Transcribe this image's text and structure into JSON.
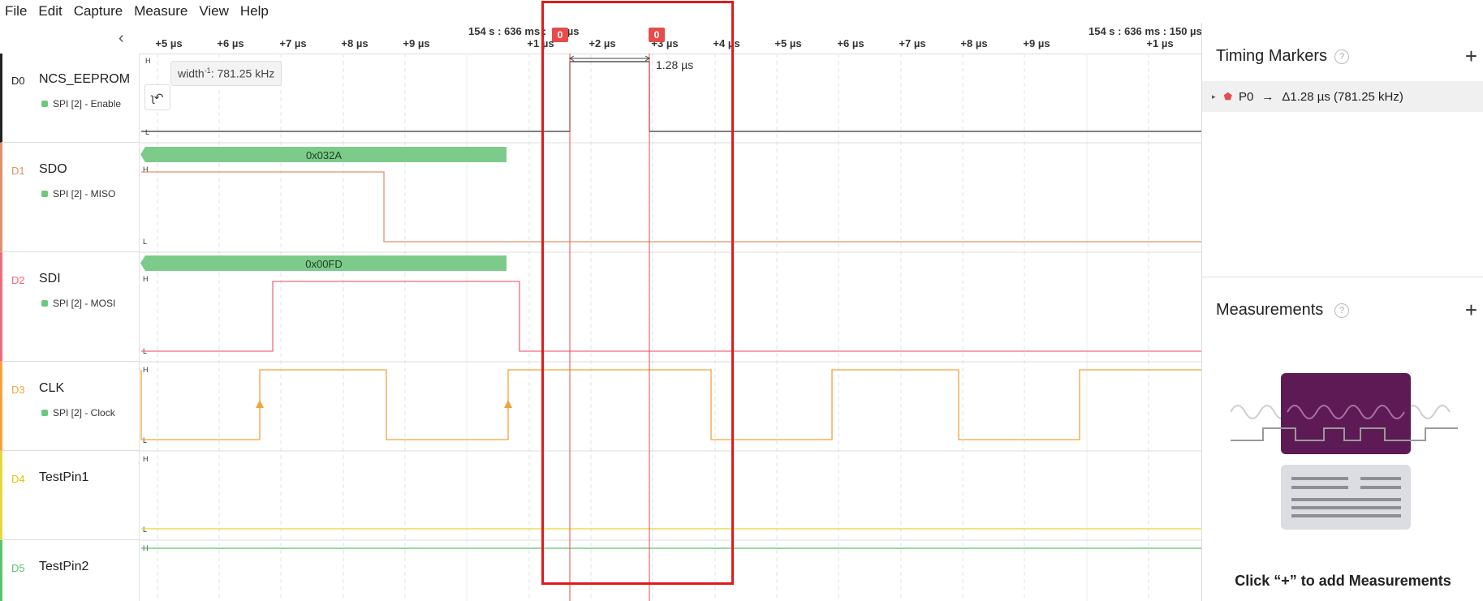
{
  "menu": [
    "File",
    "Edit",
    "Capture",
    "Measure",
    "View",
    "Help"
  ],
  "ruler": {
    "abs_left": "154 s : 636 ms : ",
    "abs_left_tail": "µs",
    "abs_right": "154 s : 636 ms : 150 µs",
    "ticks": [
      "+5 µs",
      "+6 µs",
      "+7 µs",
      "+8 µs",
      "+9 µs",
      "+1 µs",
      "+2 µs",
      "+3 µs",
      "+4 µs",
      "+5 µs",
      "+6 µs",
      "+7 µs",
      "+8 µs",
      "+9 µs",
      "+1 µs"
    ]
  },
  "markers": {
    "flag0": "0",
    "flag1": "0",
    "delta_label": "1.28 µs"
  },
  "tooltip": {
    "prefix": "width",
    "sup": "-1",
    "value": ": 781.25 kHz"
  },
  "channels": [
    {
      "id": "D0",
      "name": "NCS_EEPROM",
      "proto": "SPI [2] - Enable",
      "color": "#222222"
    },
    {
      "id": "D1",
      "name": "SDO",
      "proto": "SPI [2] - MISO",
      "color": "#e0906a"
    },
    {
      "id": "D2",
      "name": "SDI",
      "proto": "SPI [2] - MOSI",
      "color": "#f06a7f"
    },
    {
      "id": "D3",
      "name": "CLK",
      "proto": "SPI [2] - Clock",
      "color": "#f5a23c"
    },
    {
      "id": "D4",
      "name": "TestPin1",
      "proto": "",
      "color": "#e8d63a"
    },
    {
      "id": "D5",
      "name": "TestPin2",
      "proto": "",
      "color": "#5cc26e"
    }
  ],
  "decoded": {
    "sdo": "0x032A",
    "sdi": "0x00FD"
  },
  "levels": {
    "high": "H",
    "low": "L"
  },
  "sidebar": {
    "timing_title": "Timing Markers",
    "help": "?",
    "plus": "+",
    "marker_row": {
      "name": "P0",
      "arrow": "→",
      "value": "Δ1.28 µs (781.25 kHz)"
    },
    "measurements_title": "Measurements",
    "measurements_hint": "Click “+” to add Measurements"
  },
  "colors": {
    "decode_bar": "#7ccb8b",
    "marker": "#e64c4c",
    "illustration": "#5e1a55"
  }
}
